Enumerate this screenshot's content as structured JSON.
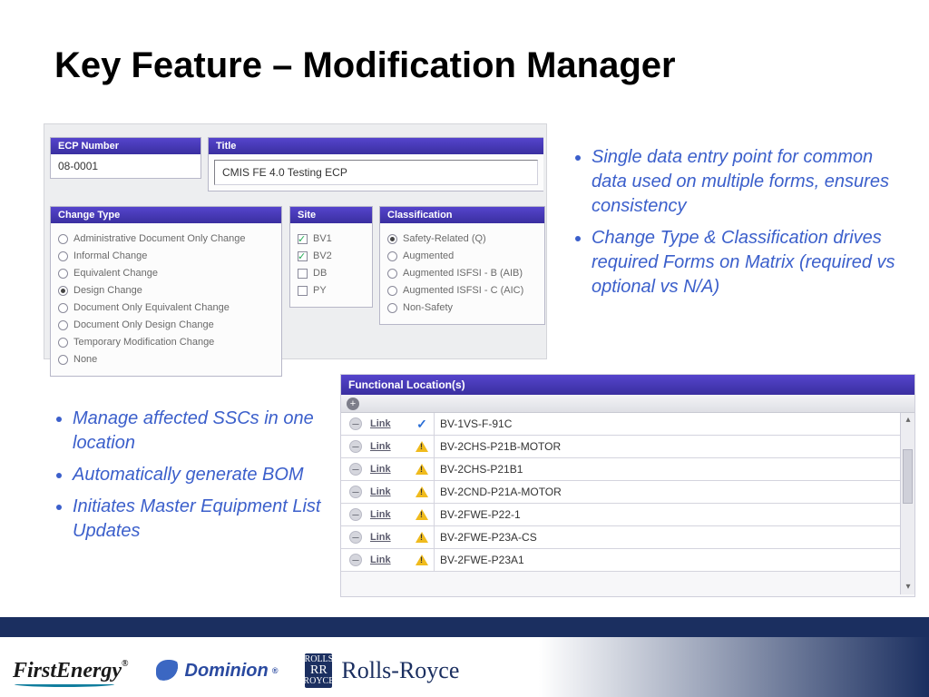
{
  "title": "Key Feature – Modification Manager",
  "ecp": {
    "header": "ECP Number",
    "value": "08-0001"
  },
  "ecpTitle": {
    "header": "Title",
    "value": "CMIS FE 4.0 Testing ECP"
  },
  "changeType": {
    "header": "Change Type",
    "options": [
      "Administrative Document Only Change",
      "Informal Change",
      "Equivalent Change",
      "Design Change",
      "Document Only Equivalent Change",
      "Document Only Design Change",
      "Temporary Modification Change",
      "None"
    ],
    "selected": 3
  },
  "site": {
    "header": "Site",
    "options": [
      "BV1",
      "BV2",
      "DB",
      "PY"
    ],
    "checked": [
      true,
      true,
      false,
      false
    ]
  },
  "classification": {
    "header": "Classification",
    "options": [
      "Safety-Related (Q)",
      "Augmented",
      "Augmented ISFSI - B (AIB)",
      "Augmented ISFSI - C (AIC)",
      "Non-Safety"
    ],
    "selected": 0
  },
  "bulletsRight": [
    "Single data entry point for common data used on multiple forms, ensures consistency",
    "Change Type & Classification drives required Forms on Matrix (required  vs optional vs N/A)"
  ],
  "bulletsLeft": [
    "Manage affected SSCs in one location",
    "Automatically generate BOM",
    "Initiates Master Equipment List Updates"
  ],
  "funcLoc": {
    "header": "Functional Location(s)",
    "linkLabel": "Link",
    "rows": [
      {
        "loc": "BV-1VS-F-91C",
        "status": "check"
      },
      {
        "loc": "BV-2CHS-P21B-MOTOR",
        "status": "warn"
      },
      {
        "loc": "BV-2CHS-P21B1",
        "status": "warn"
      },
      {
        "loc": "BV-2CND-P21A-MOTOR",
        "status": "warn"
      },
      {
        "loc": "BV-2FWE-P22-1",
        "status": "warn"
      },
      {
        "loc": "BV-2FWE-P23A-CS",
        "status": "warn"
      },
      {
        "loc": "BV-2FWE-P23A1",
        "status": "warn"
      }
    ]
  },
  "logos": {
    "firstEnergy": "FirstEnergy",
    "dominion": "Dominion",
    "rollsRoyce": "Rolls-Royce",
    "rrBadgeTop": "ROLLS",
    "rrBadgeMid": "RR",
    "rrBadgeBot": "ROYCE"
  }
}
